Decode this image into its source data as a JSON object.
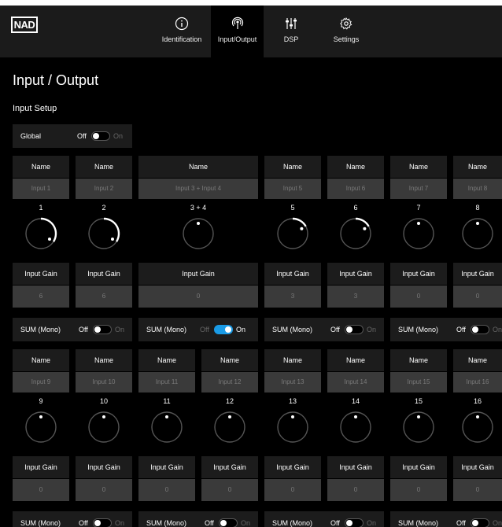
{
  "brand": "NAD",
  "nav": {
    "tabs": [
      {
        "label": "Identification",
        "icon": "info-icon"
      },
      {
        "label": "Input/Output",
        "icon": "antenna-icon",
        "active": true
      },
      {
        "label": "DSP",
        "icon": "sliders-icon"
      },
      {
        "label": "Settings",
        "icon": "gear-icon"
      }
    ]
  },
  "page_title": "Input / Output",
  "section_title": "Input Setup",
  "global": {
    "label": "Global",
    "off": "Off",
    "on": "On",
    "enabled": false
  },
  "labels": {
    "name": "Name",
    "input_gain": "Input Gain",
    "sum": "SUM (Mono)",
    "off": "Off",
    "on": "On"
  },
  "row1": {
    "channels": [
      {
        "number": "1",
        "name": "Input 1",
        "gain": "6",
        "level": 0.9
      },
      {
        "number": "2",
        "name": "Input 2",
        "gain": "6",
        "level": 0.9
      },
      {
        "number": "3 + 4",
        "name": "Input 3 + Input 4",
        "gain": "0",
        "level": 0.5
      },
      {
        "number": "5",
        "name": "Input 5",
        "gain": "3",
        "level": 0.7
      },
      {
        "number": "6",
        "name": "Input 6",
        "gain": "3",
        "level": 0.7
      },
      {
        "number": "7",
        "name": "Input 7",
        "gain": "0",
        "level": 0.5
      },
      {
        "number": "8",
        "name": "Input 8",
        "gain": "0",
        "level": 0.5
      }
    ],
    "sums": [
      {
        "enabled": false
      },
      {
        "enabled": true
      },
      {
        "enabled": false
      },
      {
        "enabled": false
      }
    ]
  },
  "row2": {
    "channels": [
      {
        "number": "9",
        "name": "Input 9",
        "gain": "0",
        "level": 0.5
      },
      {
        "number": "10",
        "name": "Input 10",
        "gain": "0",
        "level": 0.5
      },
      {
        "number": "11",
        "name": "Input 11",
        "gain": "0",
        "level": 0.5
      },
      {
        "number": "12",
        "name": "Input 12",
        "gain": "0",
        "level": 0.5
      },
      {
        "number": "13",
        "name": "Input 13",
        "gain": "0",
        "level": 0.5
      },
      {
        "number": "14",
        "name": "Input 14",
        "gain": "0",
        "level": 0.5
      },
      {
        "number": "15",
        "name": "Input 15",
        "gain": "0",
        "level": 0.5
      },
      {
        "number": "16",
        "name": "Input 16",
        "gain": "0",
        "level": 0.5
      }
    ],
    "sums": [
      {
        "enabled": false
      },
      {
        "enabled": false
      },
      {
        "enabled": false
      },
      {
        "enabled": false
      }
    ]
  },
  "colors": {
    "accent": "#1a9be6",
    "panel": "#1c1c1c",
    "field": "#3a3a3a"
  }
}
